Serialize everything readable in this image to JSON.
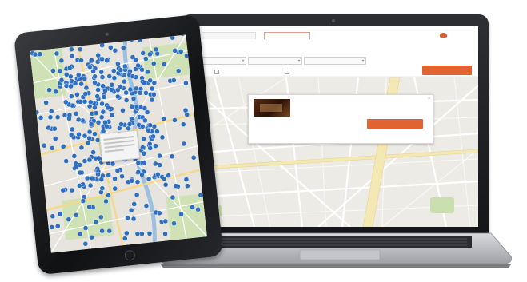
{
  "colors": {
    "accent": "#e0642f",
    "pin": "#2f6fc0",
    "map_bg": "#ecebe6"
  },
  "laptop": {
    "header": {
      "tabs": [
        {
          "label": "",
          "active": false
        },
        {
          "label": "",
          "active": true
        }
      ],
      "subtitle": "",
      "logo_icon": "restaurant-logo-icon",
      "logo_text": ""
    },
    "filters": {
      "selects": [
        {
          "value": ""
        },
        {
          "value": ""
        },
        {
          "value": ""
        }
      ],
      "options": [
        {
          "label": ""
        },
        {
          "label": ""
        },
        {
          "label": ""
        }
      ],
      "reserve_button_label": ""
    },
    "popup": {
      "restaurant_name": "",
      "address_lines": [
        "",
        ""
      ],
      "description_lines": [
        "",
        "",
        ""
      ],
      "link_text": "",
      "price": "",
      "details": [
        "",
        ""
      ],
      "book_button_label": "",
      "close_icon": "close-icon"
    }
  },
  "tablet": {
    "map_icon": "map-pins-icon"
  }
}
